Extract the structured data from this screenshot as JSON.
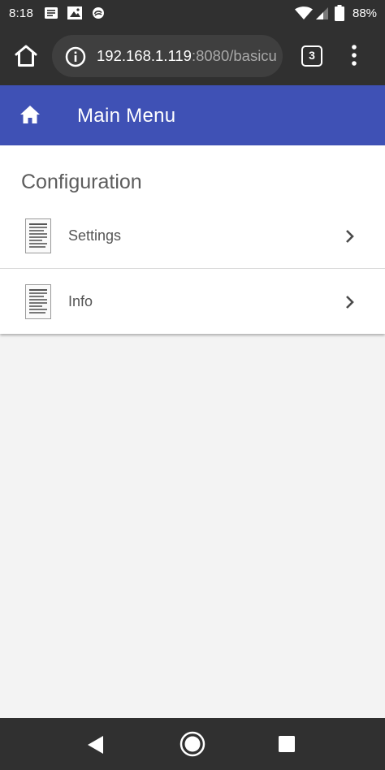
{
  "status_bar": {
    "time": "8:18",
    "battery": "88%",
    "notification_icons": [
      "news-icon",
      "photo-icon",
      "swirl-icon"
    ],
    "system_icons": [
      "wifi-icon",
      "signal-icon",
      "battery-icon"
    ]
  },
  "browser": {
    "url_host": "192.168.1.119",
    "url_rest": ":8080/basicu",
    "tab_count": "3"
  },
  "header": {
    "title": "Main Menu"
  },
  "content": {
    "section_title": "Configuration",
    "items": [
      {
        "label": "Settings",
        "icon": "document-icon"
      },
      {
        "label": "Info",
        "icon": "document-icon"
      }
    ]
  },
  "nav": {
    "buttons": [
      "back",
      "home",
      "recents"
    ]
  },
  "colors": {
    "status_bar": "#303030",
    "header": "#3f51b5",
    "card": "#ffffff",
    "background": "#f3f3f3"
  }
}
